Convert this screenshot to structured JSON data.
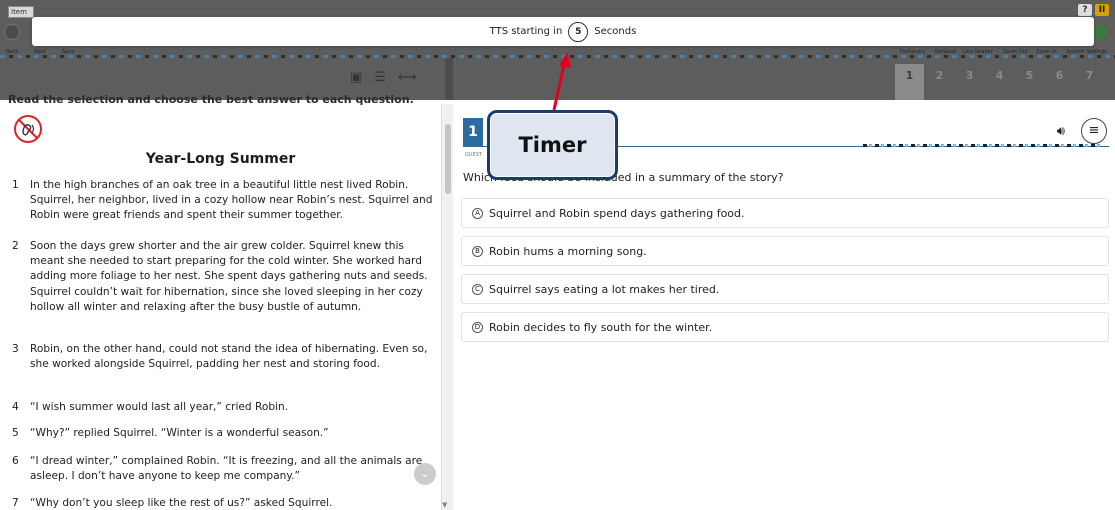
{
  "toolbar": {
    "item_tag": "Item",
    "nav_labels": [
      "Back",
      "Next",
      "Save"
    ],
    "tool_labels": [
      "Dictionary",
      "Notepad",
      "Line Reader",
      "Zoom Out",
      "Zoom In",
      "System Settings"
    ],
    "help": "?",
    "pause": "II"
  },
  "tts": {
    "prefix": "TTS starting in",
    "countdown": "5",
    "suffix": "Seconds"
  },
  "question_tabs": [
    "1",
    "2",
    "3",
    "4",
    "5",
    "6",
    "7"
  ],
  "instruction": "Read the selection and choose the best answer to each question.",
  "passage": {
    "title": "Year-Long Summer",
    "paragraphs": [
      {
        "num": "1",
        "text": "In the high branches of an oak tree in a beautiful little nest lived Robin. Squirrel, her neighbor, lived in a cozy hollow near Robin’s nest. Squirrel and Robin were great friends and spent their summer together."
      },
      {
        "num": "2",
        "text": "Soon the days grew shorter and the air grew colder. Squirrel knew this meant she needed to start preparing for the cold winter. She worked hard adding more foliage to her nest. She spent days gathering nuts and seeds. Squirrel couldn’t wait for hibernation, since she loved sleeping in her cozy hollow all winter and relaxing after the busy bustle of autumn."
      },
      {
        "num": "3",
        "text": "Robin, on the other hand, could not stand the idea of hibernating. Even so, she worked alongside Squirrel, padding her nest and storing food."
      },
      {
        "num": "4",
        "text": "“I wish summer would last all year,” cried Robin."
      },
      {
        "num": "5",
        "text": "“Why?” replied Squirrel. “Winter is a wonderful season.”"
      },
      {
        "num": "6",
        "text": "“I dread winter,” complained Robin. “It is freezing, and all the animals are asleep. I don’t have anyone to keep me company.”"
      },
      {
        "num": "7",
        "text": "“Why don’t you sleep like the rest of us?” asked Squirrel."
      }
    ]
  },
  "question": {
    "number": "1",
    "guest_label": "GUEST",
    "stem": "Which idea should be included in a summary of the story?",
    "choices": [
      {
        "letter": "A",
        "text": "Squirrel and Robin spend days gathering food."
      },
      {
        "letter": "B",
        "text": "Robin hums a morning song."
      },
      {
        "letter": "C",
        "text": "Squirrel says eating a lot makes her tired."
      },
      {
        "letter": "D",
        "text": "Robin decides to fly south for the winter."
      }
    ]
  },
  "callout": {
    "label": "Timer"
  },
  "colors": {
    "accent": "#2a6ca1",
    "arrow": "#e3001b",
    "overlay": "#5d5d5d"
  }
}
